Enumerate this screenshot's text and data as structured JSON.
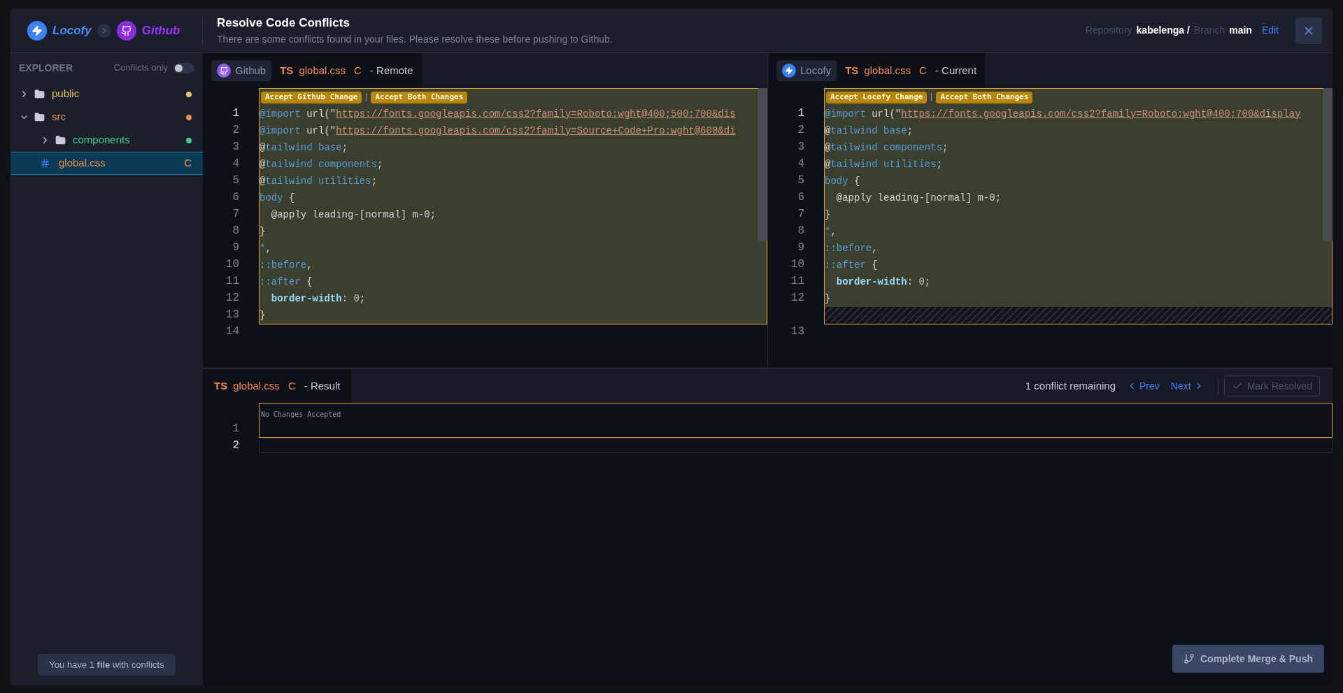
{
  "header": {
    "brand_from": "Locofy",
    "brand_to": "Github",
    "title": "Resolve Code Conflicts",
    "subtitle": "There are some conflicts found in your files. Please resolve these before pushing to Github.",
    "repo_label": "Repository",
    "repo": "kabelenga /",
    "branch_label": "Branch",
    "branch": "main",
    "edit": "Edit"
  },
  "sidebar": {
    "title": "EXPLORER",
    "filter_label": "Conflicts only",
    "filter_on": false,
    "tree": [
      {
        "kind": "folder",
        "name": "public",
        "expanded": false,
        "selected": false,
        "color": "#e9c46a"
      },
      {
        "kind": "folder",
        "name": "src",
        "expanded": true,
        "selected": false,
        "color": "#f08a4b",
        "children": [
          {
            "kind": "folder",
            "name": "components",
            "expanded": false,
            "selected": false,
            "color": "#3ecf8e"
          },
          {
            "kind": "file",
            "name": "global.css",
            "selected": true,
            "badge": "C",
            "color": "#f08a4b"
          }
        ]
      }
    ],
    "footer": "You have 1 **file** with conflicts"
  },
  "panes": [
    {
      "kind": "github",
      "source_label": "Github",
      "lang": "TS",
      "file": "global.css",
      "status": "C",
      "role": "- Remote",
      "actions": [
        "Accept Github Change",
        "Accept Both Changes"
      ],
      "filler": false,
      "conflict_lines": [
        {
          "number": "1",
          "active": true,
          "tokens": [
            {
              "kind": "kw",
              "text": "@import"
            },
            {
              "kind": "plain",
              "text": " url(\""
            },
            {
              "kind": "str",
              "text": "https://fonts.googleapis.com/css2?family=Roboto:wght@400;500;700&dis"
            }
          ]
        },
        {
          "number": "2",
          "active": false,
          "tokens": [
            {
              "kind": "kw",
              "text": "@import"
            },
            {
              "kind": "plain",
              "text": " url(\""
            },
            {
              "kind": "str",
              "text": "https://fonts.googleapis.com/css2?family=Source+Code+Pro:wght@600&di"
            }
          ]
        },
        {
          "number": "3",
          "active": false,
          "tokens": [
            {
              "kind": "plain",
              "text": "@"
            },
            {
              "kind": "kw",
              "text": "tailwind base"
            },
            {
              "kind": "plain",
              "text": ";"
            }
          ]
        },
        {
          "number": "4",
          "active": false,
          "tokens": [
            {
              "kind": "plain",
              "text": "@"
            },
            {
              "kind": "kw",
              "text": "tailwind components"
            },
            {
              "kind": "plain",
              "text": ";"
            }
          ]
        },
        {
          "number": "5",
          "active": false,
          "tokens": [
            {
              "kind": "plain",
              "text": "@"
            },
            {
              "kind": "kw",
              "text": "tailwind utilities"
            },
            {
              "kind": "plain",
              "text": ";"
            }
          ]
        },
        {
          "number": "6",
          "active": false,
          "tokens": [
            {
              "kind": "kw",
              "text": "body"
            },
            {
              "kind": "plain",
              "text": " {"
            }
          ]
        },
        {
          "number": "7",
          "active": false,
          "tokens": [
            {
              "kind": "plain",
              "text": "  @apply leading-[normal] m-0;"
            }
          ]
        },
        {
          "number": "8",
          "active": false,
          "tokens": [
            {
              "kind": "plain",
              "text": "}"
            }
          ]
        },
        {
          "number": "9",
          "active": false,
          "tokens": [
            {
              "kind": "kw",
              "text": "*"
            },
            {
              "kind": "plain",
              "text": ","
            }
          ]
        },
        {
          "number": "10",
          "active": false,
          "tokens": [
            {
              "kind": "kw",
              "text": "::before"
            },
            {
              "kind": "plain",
              "text": ","
            }
          ]
        },
        {
          "number": "11",
          "active": false,
          "tokens": [
            {
              "kind": "kw",
              "text": "::after"
            },
            {
              "kind": "plain",
              "text": " {"
            }
          ]
        },
        {
          "number": "12",
          "active": false,
          "tokens": [
            {
              "kind": "prop",
              "text": "  border-width"
            },
            {
              "kind": "plain",
              "text": ": "
            },
            {
              "kind": "num",
              "text": "0"
            },
            {
              "kind": "plain",
              "text": ";"
            }
          ]
        },
        {
          "number": "13",
          "active": false,
          "tokens": [
            {
              "kind": "plain",
              "text": "}"
            }
          ]
        }
      ],
      "after_lines": [
        {
          "number": "14",
          "active": false
        }
      ]
    },
    {
      "kind": "locofy",
      "source_label": "Locofy",
      "lang": "TS",
      "file": "global.css",
      "status": "C",
      "role": "- Current",
      "actions": [
        "Accept Locofy Change",
        "Accept Both Changes"
      ],
      "filler": true,
      "conflict_lines": [
        {
          "number": "1",
          "active": true,
          "tokens": [
            {
              "kind": "kw",
              "text": "@import"
            },
            {
              "kind": "plain",
              "text": " url(\""
            },
            {
              "kind": "str",
              "text": "https://fonts.googleapis.com/css2?family=Roboto:wght@400;700&display"
            }
          ]
        },
        {
          "number": "2",
          "active": false,
          "tokens": [
            {
              "kind": "plain",
              "text": "@"
            },
            {
              "kind": "kw",
              "text": "tailwind base"
            },
            {
              "kind": "plain",
              "text": ";"
            }
          ]
        },
        {
          "number": "3",
          "active": false,
          "tokens": [
            {
              "kind": "plain",
              "text": "@"
            },
            {
              "kind": "kw",
              "text": "tailwind components"
            },
            {
              "kind": "plain",
              "text": ";"
            }
          ]
        },
        {
          "number": "4",
          "active": false,
          "tokens": [
            {
              "kind": "plain",
              "text": "@"
            },
            {
              "kind": "kw",
              "text": "tailwind utilities"
            },
            {
              "kind": "plain",
              "text": ";"
            }
          ]
        },
        {
          "number": "5",
          "active": false,
          "tokens": [
            {
              "kind": "kw",
              "text": "body"
            },
            {
              "kind": "plain",
              "text": " {"
            }
          ]
        },
        {
          "number": "6",
          "active": false,
          "tokens": [
            {
              "kind": "plain",
              "text": "  @apply leading-[normal] m-0;"
            }
          ]
        },
        {
          "number": "7",
          "active": false,
          "tokens": [
            {
              "kind": "plain",
              "text": "}"
            }
          ]
        },
        {
          "number": "8",
          "active": false,
          "tokens": [
            {
              "kind": "kw",
              "text": "*"
            },
            {
              "kind": "plain",
              "text": ","
            }
          ]
        },
        {
          "number": "9",
          "active": false,
          "tokens": [
            {
              "kind": "kw",
              "text": "::before"
            },
            {
              "kind": "plain",
              "text": ","
            }
          ]
        },
        {
          "number": "10",
          "active": false,
          "tokens": [
            {
              "kind": "kw",
              "text": "::after"
            },
            {
              "kind": "plain",
              "text": " {"
            }
          ]
        },
        {
          "number": "11",
          "active": false,
          "tokens": [
            {
              "kind": "prop",
              "text": "  border-width"
            },
            {
              "kind": "plain",
              "text": ": "
            },
            {
              "kind": "num",
              "text": "0"
            },
            {
              "kind": "plain",
              "text": ";"
            }
          ]
        },
        {
          "number": "12",
          "active": false,
          "tokens": [
            {
              "kind": "plain",
              "text": "}"
            }
          ]
        }
      ],
      "after_lines": [
        {
          "number": "13",
          "active": false
        }
      ]
    }
  ],
  "result": {
    "lang": "TS",
    "file": "global.css",
    "status": "C",
    "role": "- Result",
    "remaining": "1 conflict remaining",
    "prev": "Prev",
    "next": "Next",
    "mark_resolved": "Mark Resolved",
    "mark_disabled": true,
    "placeholder": "No Changes Accepted",
    "lines": [
      {
        "number": "1",
        "active": false
      },
      {
        "number": "2",
        "active": true
      }
    ]
  },
  "complete_button": "Complete Merge & Push"
}
